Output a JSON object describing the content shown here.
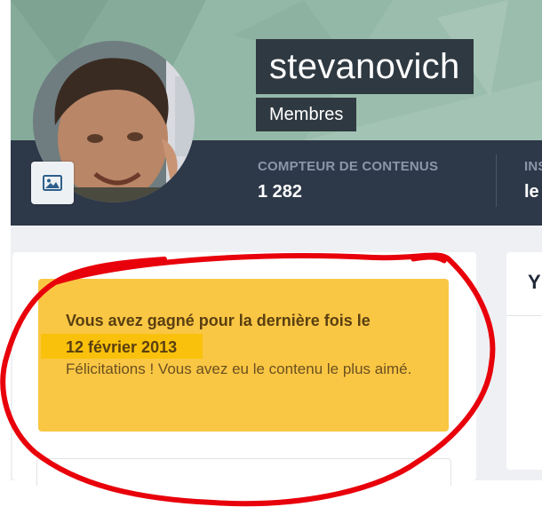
{
  "profile": {
    "username": "stevanovich",
    "group": "Membres"
  },
  "stats": [
    {
      "label": "COMPTEUR DE CONTENUS",
      "value": "1 282"
    },
    {
      "label": "INS",
      "value": "le"
    }
  ],
  "award": {
    "title": "Vous avez gagné pour la dernière fois le",
    "date": "12 février 2013",
    "description": "Félicitations ! Vous avez eu le contenu le plus aimé."
  },
  "side_card": {
    "title": "Y"
  },
  "icons": {
    "photo_button": "image-icon"
  },
  "colors": {
    "award_background": "#fac744",
    "date_highlight": "#f9c10b",
    "info_bar": "#2d3848",
    "annotation": "#e8000b"
  }
}
